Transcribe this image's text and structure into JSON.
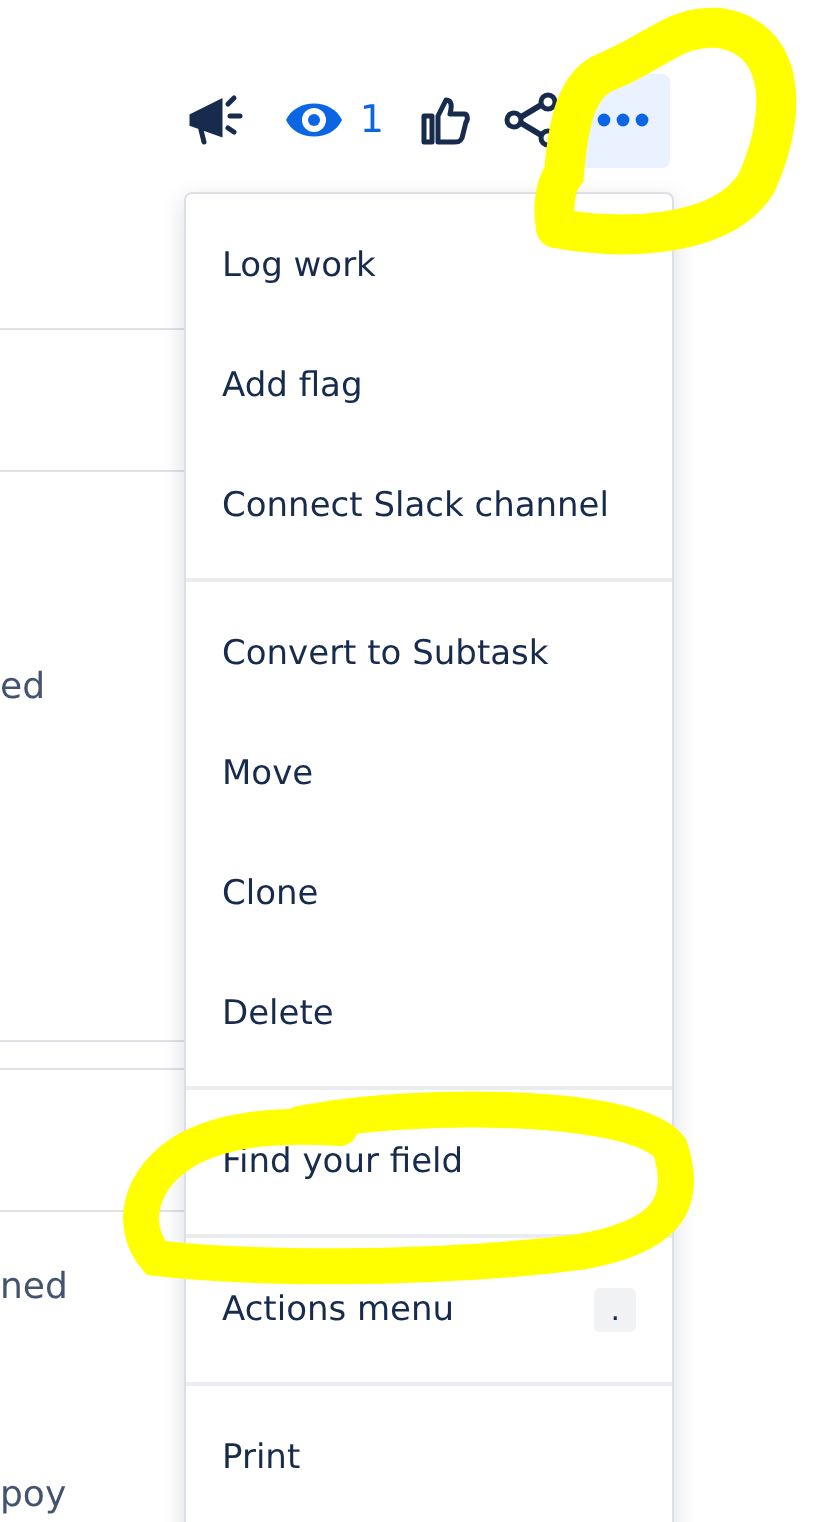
{
  "toolbar": {
    "watchers": "1",
    "more_open": true
  },
  "background_text": [
    "ed",
    "ned",
    "poy"
  ],
  "menu": {
    "sections": [
      {
        "items": [
          {
            "label": "Log work"
          },
          {
            "label": "Add flag"
          },
          {
            "label": "Connect Slack channel"
          }
        ]
      },
      {
        "items": [
          {
            "label": "Convert to Subtask"
          },
          {
            "label": "Move"
          },
          {
            "label": "Clone"
          },
          {
            "label": "Delete"
          }
        ]
      },
      {
        "items": [
          {
            "label": "Find your field"
          }
        ]
      },
      {
        "items": [
          {
            "label": "Actions menu",
            "shortcut": "."
          }
        ]
      },
      {
        "items": [
          {
            "label": "Print"
          }
        ]
      }
    ]
  }
}
